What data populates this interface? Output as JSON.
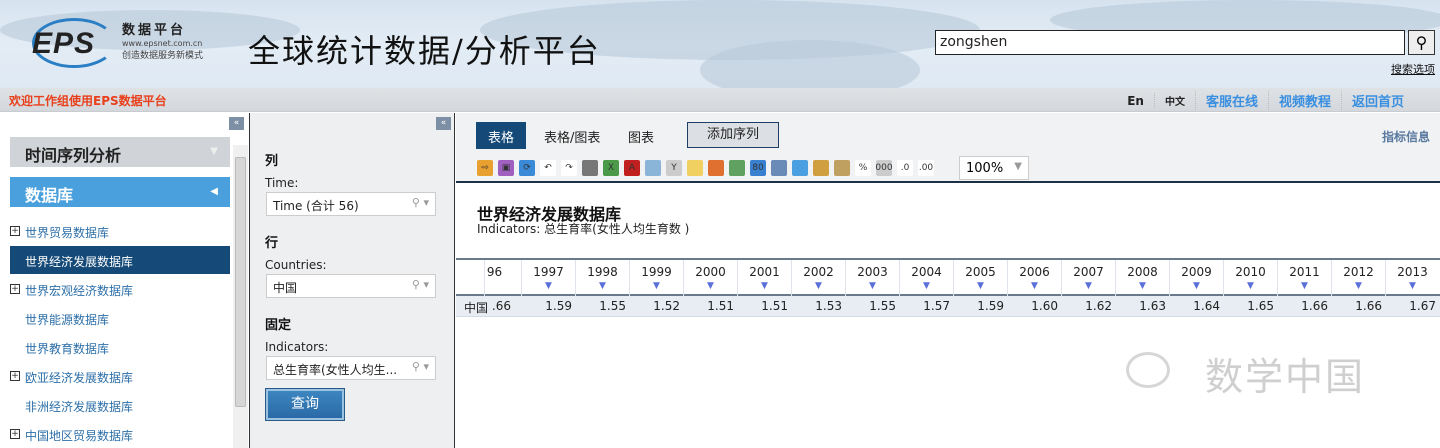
{
  "header": {
    "logo_text": "EPS",
    "logo_line1": "数据平台",
    "logo_line2": "www.epsnet.com.cn",
    "logo_line3": "创造数据服务新模式",
    "banner_title": "全球统计数据/分析平台",
    "search_value": "zongshen",
    "search_options": "搜索选项"
  },
  "navbar": {
    "welcome": "欢迎工作组使用EPS数据平台",
    "lang_en": "En",
    "lang_zh": "中文",
    "links": [
      "客服在线",
      "视频教程",
      "返回首页"
    ]
  },
  "sidebar": {
    "collapse": "«",
    "section_timeseries": "时间序列分析",
    "section_db": "数据库",
    "items": [
      {
        "label": "世界贸易数据库",
        "expandable": true
      },
      {
        "label": "世界经济发展数据库",
        "selected": true
      },
      {
        "label": "世界宏观经济数据库",
        "expandable": true
      },
      {
        "label": "世界能源数据库"
      },
      {
        "label": "世界教育数据库"
      },
      {
        "label": "欧亚经济发展数据库",
        "expandable": true
      },
      {
        "label": "非洲经济发展数据库"
      },
      {
        "label": "中国地区贸易数据库",
        "expandable": true
      }
    ]
  },
  "filters": {
    "collapse": "«",
    "col_heading": "列",
    "time_label": "Time:",
    "time_value": "Time (合计 56)",
    "row_heading": "行",
    "countries_label": "Countries:",
    "countries_value": "中国",
    "fixed_heading": "固定",
    "indicators_label": "Indicators:",
    "indicators_value": "总生育率(女性人均生...",
    "query_button": "查询"
  },
  "main": {
    "tabs": [
      "表格",
      "表格/图表",
      "图表"
    ],
    "add_series": "添加序列",
    "indicator_info": "指标信息",
    "zoom": "100%",
    "report_title": "世界经济发展数据库",
    "report_subtitle": "Indicators: 总生育率(女性人均生育数 )",
    "table": {
      "partial_col": "96",
      "years": [
        "1997",
        "1998",
        "1999",
        "2000",
        "2001",
        "2002",
        "2003",
        "2004",
        "2005",
        "2006",
        "2007",
        "2008",
        "2009",
        "2010",
        "2011",
        "2012",
        "2013"
      ],
      "row_label": "中国",
      "partial_value": ".66",
      "values": [
        "1.59",
        "1.55",
        "1.52",
        "1.51",
        "1.51",
        "1.53",
        "1.55",
        "1.57",
        "1.59",
        "1.60",
        "1.62",
        "1.63",
        "1.64",
        "1.65",
        "1.66",
        "1.66",
        "1.67"
      ]
    }
  },
  "watermark": "数学中国"
}
